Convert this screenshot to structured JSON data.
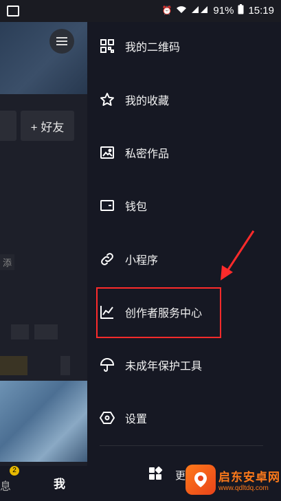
{
  "status_bar": {
    "battery": "91%",
    "time": "15:19"
  },
  "background": {
    "add_friend_label": "+ 好友",
    "blurred_text": "添",
    "tab_messages": "息",
    "tab_me": "我",
    "badge_count": "2"
  },
  "drawer": {
    "items": [
      {
        "label": "我的二维码",
        "icon": "qr-code-icon"
      },
      {
        "label": "我的收藏",
        "icon": "star-icon"
      },
      {
        "label": "私密作品",
        "icon": "image-icon"
      },
      {
        "label": "钱包",
        "icon": "wallet-icon"
      },
      {
        "label": "小程序",
        "icon": "link-icon"
      },
      {
        "label": "创作者服务中心",
        "icon": "chart-icon"
      },
      {
        "label": "未成年保护工具",
        "icon": "umbrella-icon"
      },
      {
        "label": "设置",
        "icon": "hexagon-settings-icon"
      }
    ],
    "more_label": "更多"
  },
  "watermark": {
    "title": "启东安卓网",
    "url": "www.qdltdq.com"
  },
  "colors": {
    "background": "#161823",
    "highlight": "#ff2b2b",
    "accent": "#ff7a1a"
  }
}
